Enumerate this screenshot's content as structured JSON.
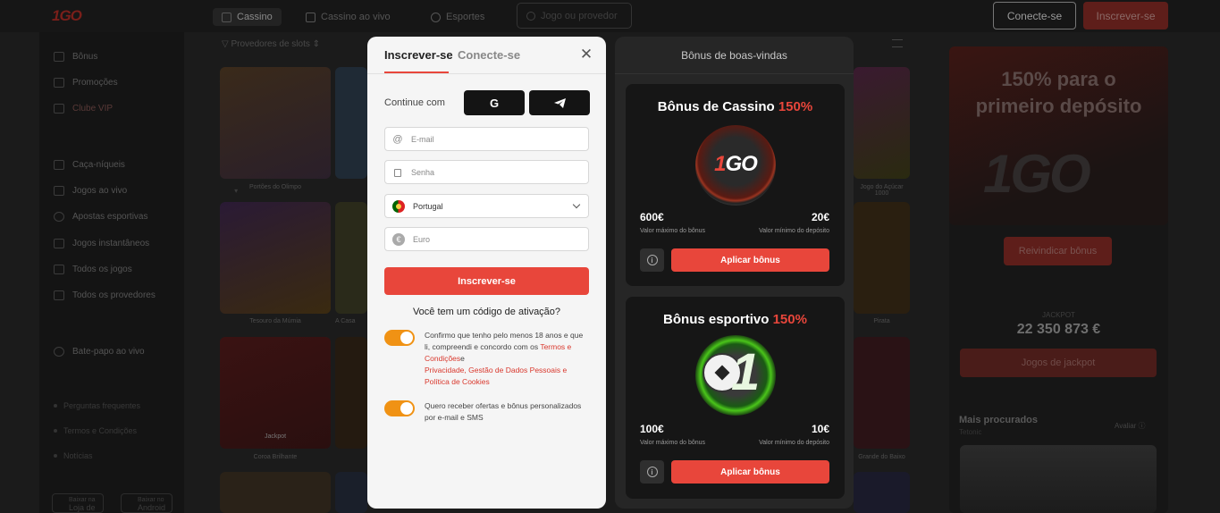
{
  "header": {
    "logo": "1GO",
    "nav": [
      {
        "label": "Cassino",
        "icon": "dice-icon"
      },
      {
        "label": "Cassino ao vivo",
        "icon": "live-icon"
      },
      {
        "label": "Esportes",
        "icon": "ball-icon"
      }
    ],
    "search_placeholder": "Jogo ou provedor",
    "connect_label": "Conecte-se",
    "register_label": "Inscrever-se"
  },
  "sidebar": {
    "items": [
      {
        "label": "Bônus"
      },
      {
        "label": "Promoções"
      },
      {
        "label": "Clube VIP"
      },
      {
        "label": "Caça-níqueis"
      },
      {
        "label": "Jogos ao vivo"
      },
      {
        "label": "Apostas esportivas"
      },
      {
        "label": "Jogos instantâneos"
      },
      {
        "label": "Todos os jogos"
      },
      {
        "label": "Todos os provedores"
      },
      {
        "label": "Bate-papo ao vivo"
      }
    ],
    "footer": [
      "Perguntas frequentes",
      "Termos e Condições",
      "Notícias"
    ],
    "downloads": [
      {
        "small": "Baixar na",
        "big": "Loja de"
      },
      {
        "small": "Baixar no",
        "big": "Android"
      }
    ]
  },
  "games": {
    "filter_providers": "Provedores de slots",
    "captions": [
      "Portões do Olimpo",
      "Tesouro da Múmia",
      "A Casa",
      "Coroa Brilhante",
      "Jackpot",
      "Jogo do Açúcar 1000",
      "Pirata",
      "Grande do Baixo"
    ],
    "jackpot_badge": "Jackpot"
  },
  "right_panel": {
    "promo_line1": "150% para o",
    "promo_line2": "primeiro depósito",
    "promo_logo": "1GO",
    "claim_label": "Reivindicar bônus",
    "jackpot_label": "JACKPOT",
    "jackpot_value": "22 350 873 €",
    "jackpot_button": "Jogos de jackpot",
    "most_played": "Mais procurados",
    "most_played_sub": "Tetonic",
    "rate_label": "Avaliar"
  },
  "modal": {
    "tab_register": "Inscrever-se",
    "tab_login": "Conecte-se",
    "continue_with": "Continue com",
    "google_label": "G",
    "email_placeholder": "E-mail",
    "password_placeholder": "Senha",
    "country_value": "Portugal",
    "currency_placeholder": "Euro",
    "submit_label": "Inscrever-se",
    "activation_question": "Você tem um código de ativação?",
    "consent_text": "Confirmo que tenho pelo menos 18 anos e que li, compreendi e concordo com os",
    "terms_link": "Termos e Condições",
    "consent_connector": "e",
    "privacy_link": "Privacidade, Gestão de Dados Pessoais e Política de Cookies",
    "offers_text": "Quero receber ofertas e bônus personalizados por e-mail e SMS"
  },
  "bonus_panel": {
    "title": "Bônus de boas-vindas",
    "cards": [
      {
        "title": "Bônus de Cassino",
        "percent": "150%",
        "badge_logo_a": "1",
        "badge_logo_b": "GO",
        "max_value": "600€",
        "max_label": "Valor máximo do bônus",
        "min_value": "20€",
        "min_label": "Valor mínimo do depósito",
        "apply_label": "Aplicar bônus",
        "info_symbol": "i"
      },
      {
        "title": "Bônus esportivo",
        "percent": "150%",
        "badge_number": "1",
        "max_value": "100€",
        "max_label": "Valor máximo do bônus",
        "min_value": "10€",
        "min_label": "Valor mínimo do depósito",
        "apply_label": "Aplicar bônus",
        "info_symbol": "i"
      }
    ]
  },
  "colors": {
    "accent": "#e8463b",
    "toggle": "#f09214",
    "backdrop": "#1b1b1b"
  }
}
